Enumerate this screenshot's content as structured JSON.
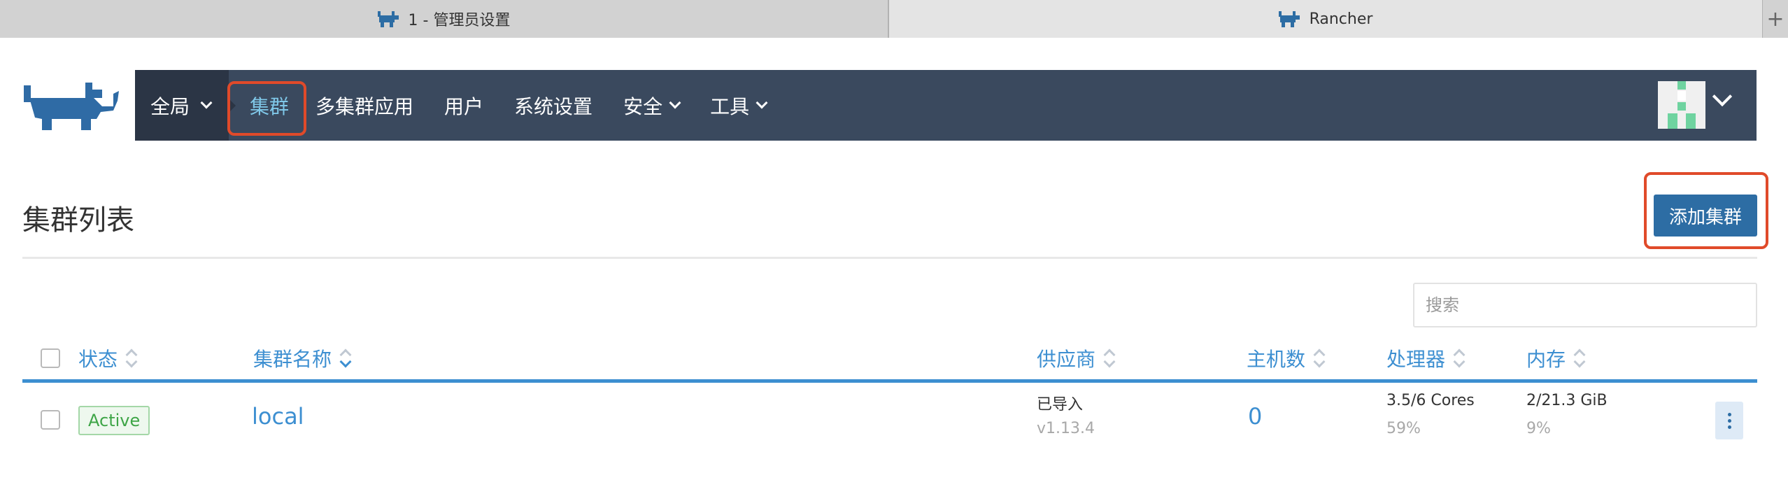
{
  "browser": {
    "tabs": [
      {
        "label": "1 - 管理员设置",
        "active": false
      },
      {
        "label": "Rancher",
        "active": true
      }
    ],
    "new_tab": "+"
  },
  "nav": {
    "global": "全局",
    "items": [
      {
        "label": "集群",
        "active": true
      },
      {
        "label": "多集群应用"
      },
      {
        "label": "用户"
      },
      {
        "label": "系统设置"
      },
      {
        "label": "安全",
        "dropdown": true
      },
      {
        "label": "工具",
        "dropdown": true
      }
    ]
  },
  "page": {
    "title": "集群列表",
    "add_button": "添加集群",
    "search_placeholder": "搜索"
  },
  "table": {
    "columns": [
      "状态",
      "集群名称",
      "供应商",
      "主机数",
      "处理器",
      "内存"
    ],
    "rows": [
      {
        "state": "Active",
        "name": "local",
        "provider": "已导入",
        "version": "v1.13.4",
        "nodes": "0",
        "cpu": "3.5/6 Cores",
        "cpu_pct": "59%",
        "memory": "2/21.3 GiB",
        "memory_pct": "9%"
      }
    ]
  },
  "colors": {
    "nav_bg": "#3a495e",
    "accent": "#3d8fd1",
    "button": "#2d6da4",
    "highlight": "#e04a2a",
    "active_green": "#3ea547"
  },
  "icons": [
    "rancher-logo-icon",
    "chevron-down-icon",
    "kebab-menu-icon",
    "sort-icon"
  ]
}
